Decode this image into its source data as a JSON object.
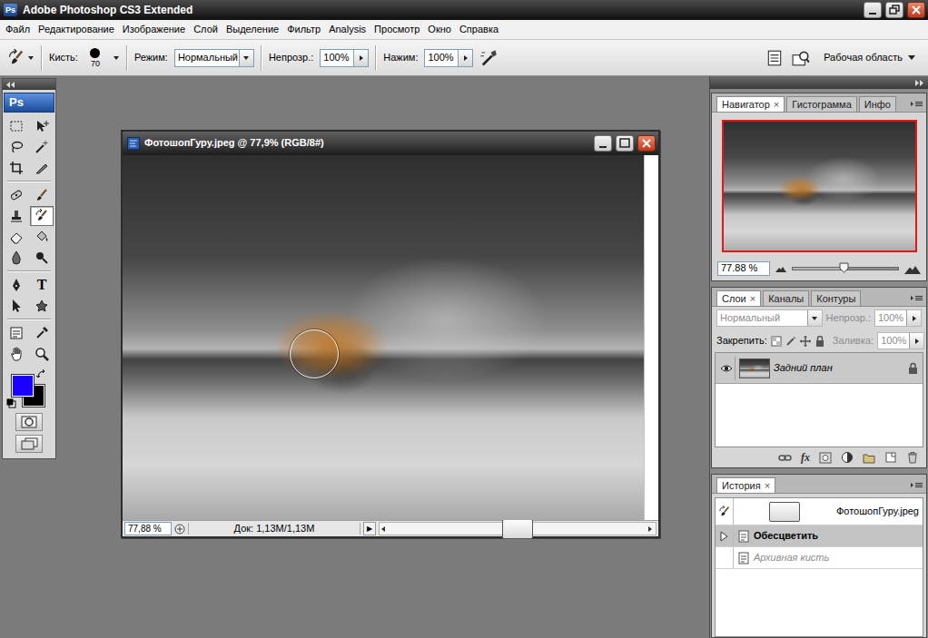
{
  "window": {
    "icon": "Ps",
    "title": "Adobe Photoshop CS3 Extended"
  },
  "menu": [
    {
      "label": "Файл"
    },
    {
      "label": "Редактирование"
    },
    {
      "label": "Изображение"
    },
    {
      "label": "Слой"
    },
    {
      "label": "Выделение"
    },
    {
      "label": "Фильтр"
    },
    {
      "label": "Analysis"
    },
    {
      "label": "Просмотр"
    },
    {
      "label": "Окно"
    },
    {
      "label": "Справка"
    }
  ],
  "options": {
    "brush_label": "Кисть:",
    "brush_size": "70",
    "mode_label": "Режим:",
    "mode": "Нормальный",
    "opacity_label": "Непрозр.:",
    "opacity": "100%",
    "flow_label": "Нажим:",
    "flow": "100%",
    "workspace": "Рабочая область"
  },
  "toolbox": {
    "logo": "Ps",
    "tools": [
      {
        "selected": false
      },
      {
        "selected": false
      },
      {
        "selected": false
      },
      {
        "selected": false
      },
      {
        "selected": false
      },
      {
        "selected": false
      },
      {
        "selected": false
      },
      {
        "selected": false
      },
      {
        "selected": false
      },
      {
        "selected": true
      },
      {
        "selected": false
      },
      {
        "selected": false
      },
      {
        "selected": false
      },
      {
        "selected": false
      },
      {
        "selected": false
      },
      {
        "selected": false,
        "label": "T"
      },
      {
        "selected": false
      },
      {
        "selected": false
      },
      {
        "selected": false
      },
      {
        "selected": false
      },
      {
        "selected": false
      },
      {
        "selected": false
      }
    ],
    "swatches": [
      {
        "color": "#1a00ff"
      },
      {
        "color": "#000000"
      }
    ]
  },
  "document": {
    "title": "ФотошопГуру.jpeg @ 77,9% (RGB/8#)",
    "zoom": "77,88 %",
    "info": "Док: 1,13M/1,13M",
    "info_menu": "▶"
  },
  "navigator": {
    "tabs": [
      {
        "label": "Навигатор",
        "selected": true,
        "close": "×"
      },
      {
        "label": "Гистограмма",
        "selected": false
      },
      {
        "label": "Инфо",
        "selected": false
      }
    ],
    "zoom": "77.88 %",
    "level": 0.48
  },
  "layers": {
    "tabs": [
      {
        "label": "Слои",
        "selected": true,
        "close": "×"
      },
      {
        "label": "Каналы",
        "selected": false
      },
      {
        "label": "Контуры",
        "selected": false
      }
    ],
    "blend": {
      "value": "Нормальный",
      "disabled": true
    },
    "opacity": {
      "label": "Непрозр.:",
      "value": "100%",
      "disabled": true
    },
    "lock_label": "Закрепить:",
    "fill": {
      "label": "Заливка:",
      "value": "100%",
      "disabled": true
    },
    "items": [
      {
        "name": "Задний план",
        "visible": true,
        "selected": true,
        "locked": true
      }
    ],
    "fx": "fx"
  },
  "history": {
    "tabs": [
      {
        "label": "История",
        "selected": true,
        "close": "×"
      }
    ],
    "items": [
      {
        "label": "ФотошопГуру.jpeg",
        "kind": "snapshot",
        "selected": false,
        "undone": false,
        "source": true
      },
      {
        "label": "Обесцветить",
        "kind": "step",
        "selected": true,
        "undone": false,
        "source": false
      },
      {
        "label": "Архивная кисть",
        "kind": "step",
        "selected": false,
        "undone": true,
        "source": false
      }
    ]
  }
}
